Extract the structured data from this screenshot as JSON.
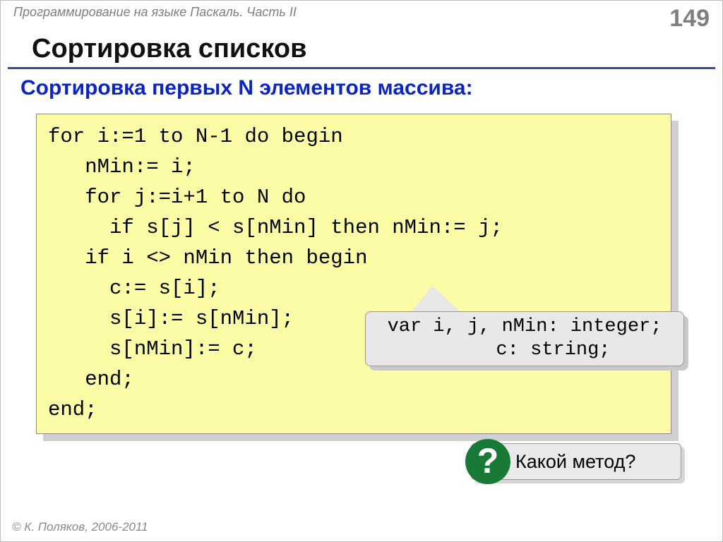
{
  "header": {
    "doc_title": "Программирование на языке Паскаль. Часть II",
    "page_number": "149"
  },
  "title": "Сортировка списков",
  "subtitle": "Сортировка первых N элементов массива:",
  "code": "for i:=1 to N-1 do begin\n   nMin:= i;\n   for j:=i+1 to N do\n     if s[j] < s[nMin] then nMin:= j;\n   if i <> nMin then begin\n     c:= s[i];\n     s[i]:= s[nMin];\n     s[nMin]:= c;\n   end;\nend;",
  "callout": "var i, j, nMin: integer;\n     c: string;",
  "question": {
    "mark": "?",
    "text": "Какой метод?"
  },
  "footer": "© К. Поляков, 2006-2011"
}
